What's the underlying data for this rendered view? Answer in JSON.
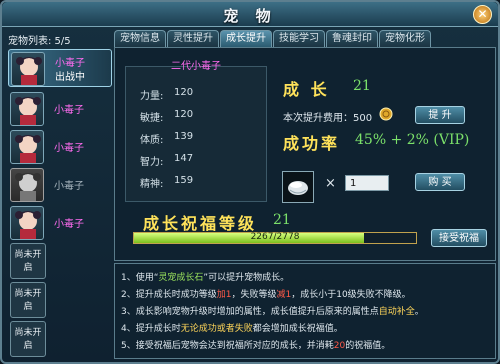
{
  "window": {
    "title": "宠 物",
    "close": "✕"
  },
  "sidebar": {
    "title": "宠物列表: 5/5",
    "pets": [
      {
        "name": "小毒子",
        "status": "出战中"
      },
      {
        "name": "小毒子"
      },
      {
        "name": "小毒子"
      },
      {
        "name": "小毒子"
      },
      {
        "name": "小毒子"
      }
    ],
    "locked": [
      "尚未开启",
      "尚未开启",
      "尚未开启"
    ]
  },
  "tabs": [
    "宠物信息",
    "灵性提升",
    "成长提升",
    "技能学习",
    "鲁魂封印",
    "宠物化形"
  ],
  "active_tab": 2,
  "stats": {
    "title": "二代小毒子",
    "rows": [
      {
        "label": "力量:",
        "value": "120"
      },
      {
        "label": "敏捷:",
        "value": "120"
      },
      {
        "label": "体质:",
        "value": "139"
      },
      {
        "label": "智力:",
        "value": "147"
      },
      {
        "label": "精神:",
        "value": "159"
      }
    ]
  },
  "growth": {
    "label": "成 长",
    "value": "21",
    "cost_label": "本次提升费用：500",
    "upgrade_btn": "提 升",
    "success_label": "成功率",
    "success_value": "45% + 2% (VIP)",
    "qty": "1",
    "times": "×",
    "buy_btn": "购 买"
  },
  "blessing": {
    "label": "成长祝福等级",
    "level": "21",
    "progress_text": "2267/2778",
    "progress": 0.816,
    "accept_btn": "接受祝福"
  },
  "notes": [
    [
      "1、使用“",
      "灵宠成长石",
      "”可以提升宠物成长。"
    ],
    [
      "2、提升成长时成功等级",
      "加1",
      "，失败等级",
      "减1",
      "，成长小于10级失败不降级。"
    ],
    [
      "3、成长影响宠物升级时增加的属性，成长值提升后原来的属性点",
      "自动补全",
      "。"
    ],
    [
      "4、提升成长时",
      "无论成功或者失败",
      "都会增加成长祝福值。"
    ],
    [
      "5、接受祝福后宠物会达到祝福所对应的成长，并消耗",
      "20",
      "的祝福值。"
    ]
  ],
  "colors": {
    "pet_name": "#ff6cf0",
    "gold": "#ffe25a",
    "green": "#7be06a"
  }
}
